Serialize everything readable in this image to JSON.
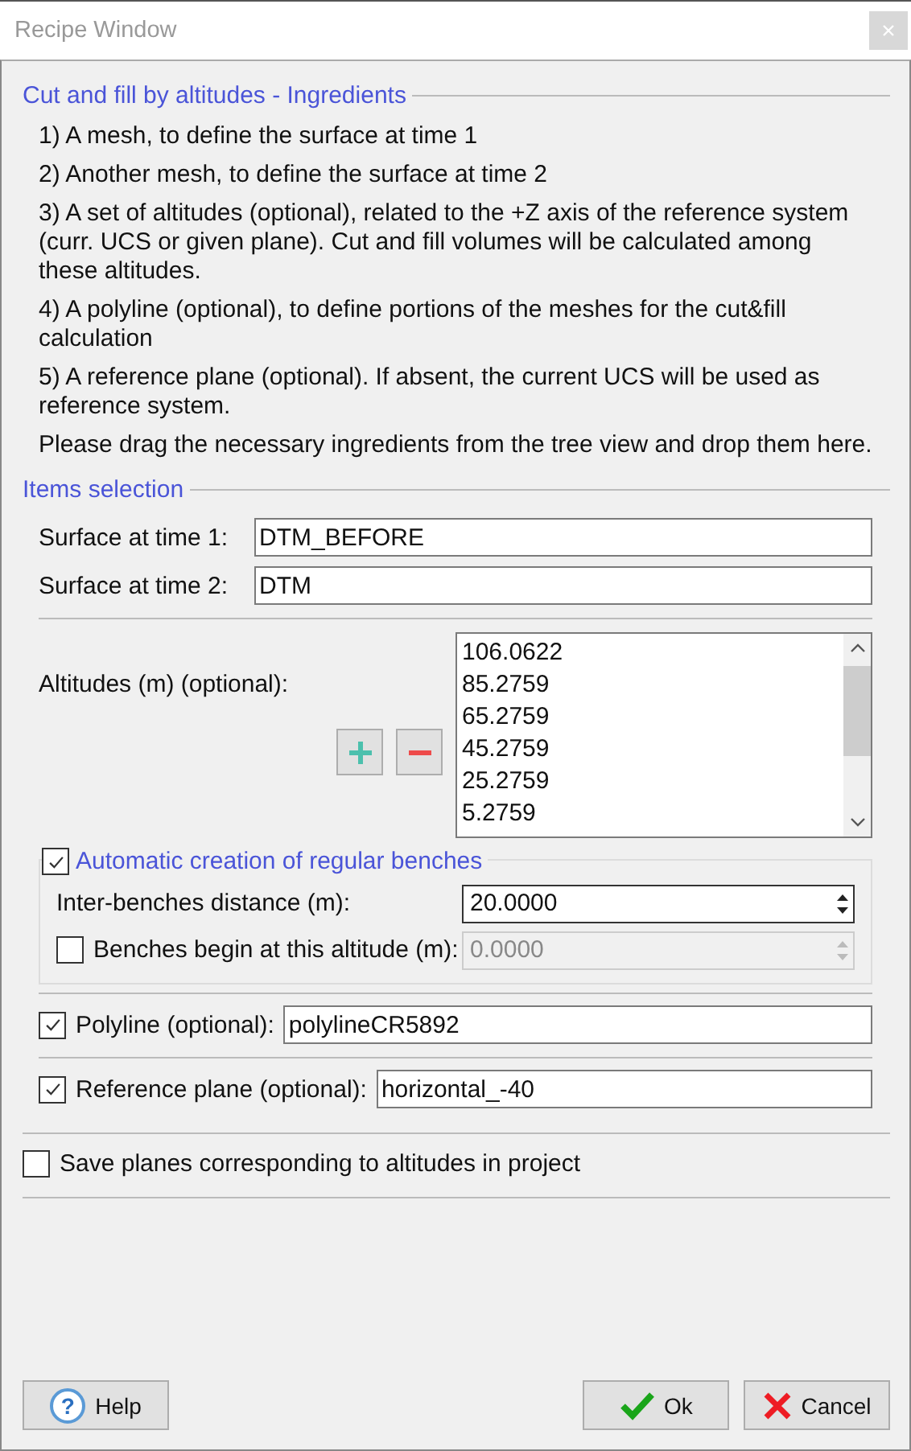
{
  "window": {
    "title": "Recipe Window"
  },
  "ingredients": {
    "title": "Cut and fill by altitudes - Ingredients",
    "items": [
      "1) A mesh, to define the surface at time 1",
      "2) Another mesh, to define the surface at time 2",
      "3) A set of altitudes (optional), related to the +Z axis of the reference system (curr. UCS or given plane). Cut and fill volumes will be calculated among these altitudes.",
      "4) A polyline (optional), to define portions of the meshes for the cut&fill calculation",
      "5) A reference plane (optional). If absent, the current UCS will be used as reference system.",
      "Please drag the necessary ingredients from the tree view and drop them here."
    ]
  },
  "items_selection": {
    "title": "Items selection",
    "surfaces": [
      {
        "label": "Surface at time 1:",
        "value": "DTM_BEFORE"
      },
      {
        "label": "Surface at time 2:",
        "value": "DTM"
      }
    ],
    "altitudes": {
      "label": "Altitudes (m) (optional):",
      "values": [
        "106.0622",
        "85.2759",
        "65.2759",
        "45.2759",
        "25.2759",
        "5.2759"
      ]
    },
    "benches": {
      "checked": true,
      "title": "Automatic creation of regular benches",
      "distance": {
        "label": "Inter-benches distance (m):",
        "value": "20.0000",
        "disabled": false
      },
      "begin": {
        "checked": false,
        "label": "Benches begin at this altitude (m):",
        "value": "0.0000",
        "disabled": true
      }
    },
    "polyline": {
      "checked": true,
      "label": "Polyline (optional):",
      "value": "polylineCR5892"
    },
    "reference_plane": {
      "checked": true,
      "label": "Reference plane (optional):",
      "value": "horizontal_-40"
    }
  },
  "save_planes": {
    "checked": false,
    "label": "Save planes corresponding to altitudes in project"
  },
  "buttons": [
    {
      "kind": "help",
      "label": "Help",
      "icon": "?"
    },
    {
      "kind": "ok",
      "label": "Ok"
    },
    {
      "kind": "cancel",
      "label": "Cancel"
    }
  ]
}
